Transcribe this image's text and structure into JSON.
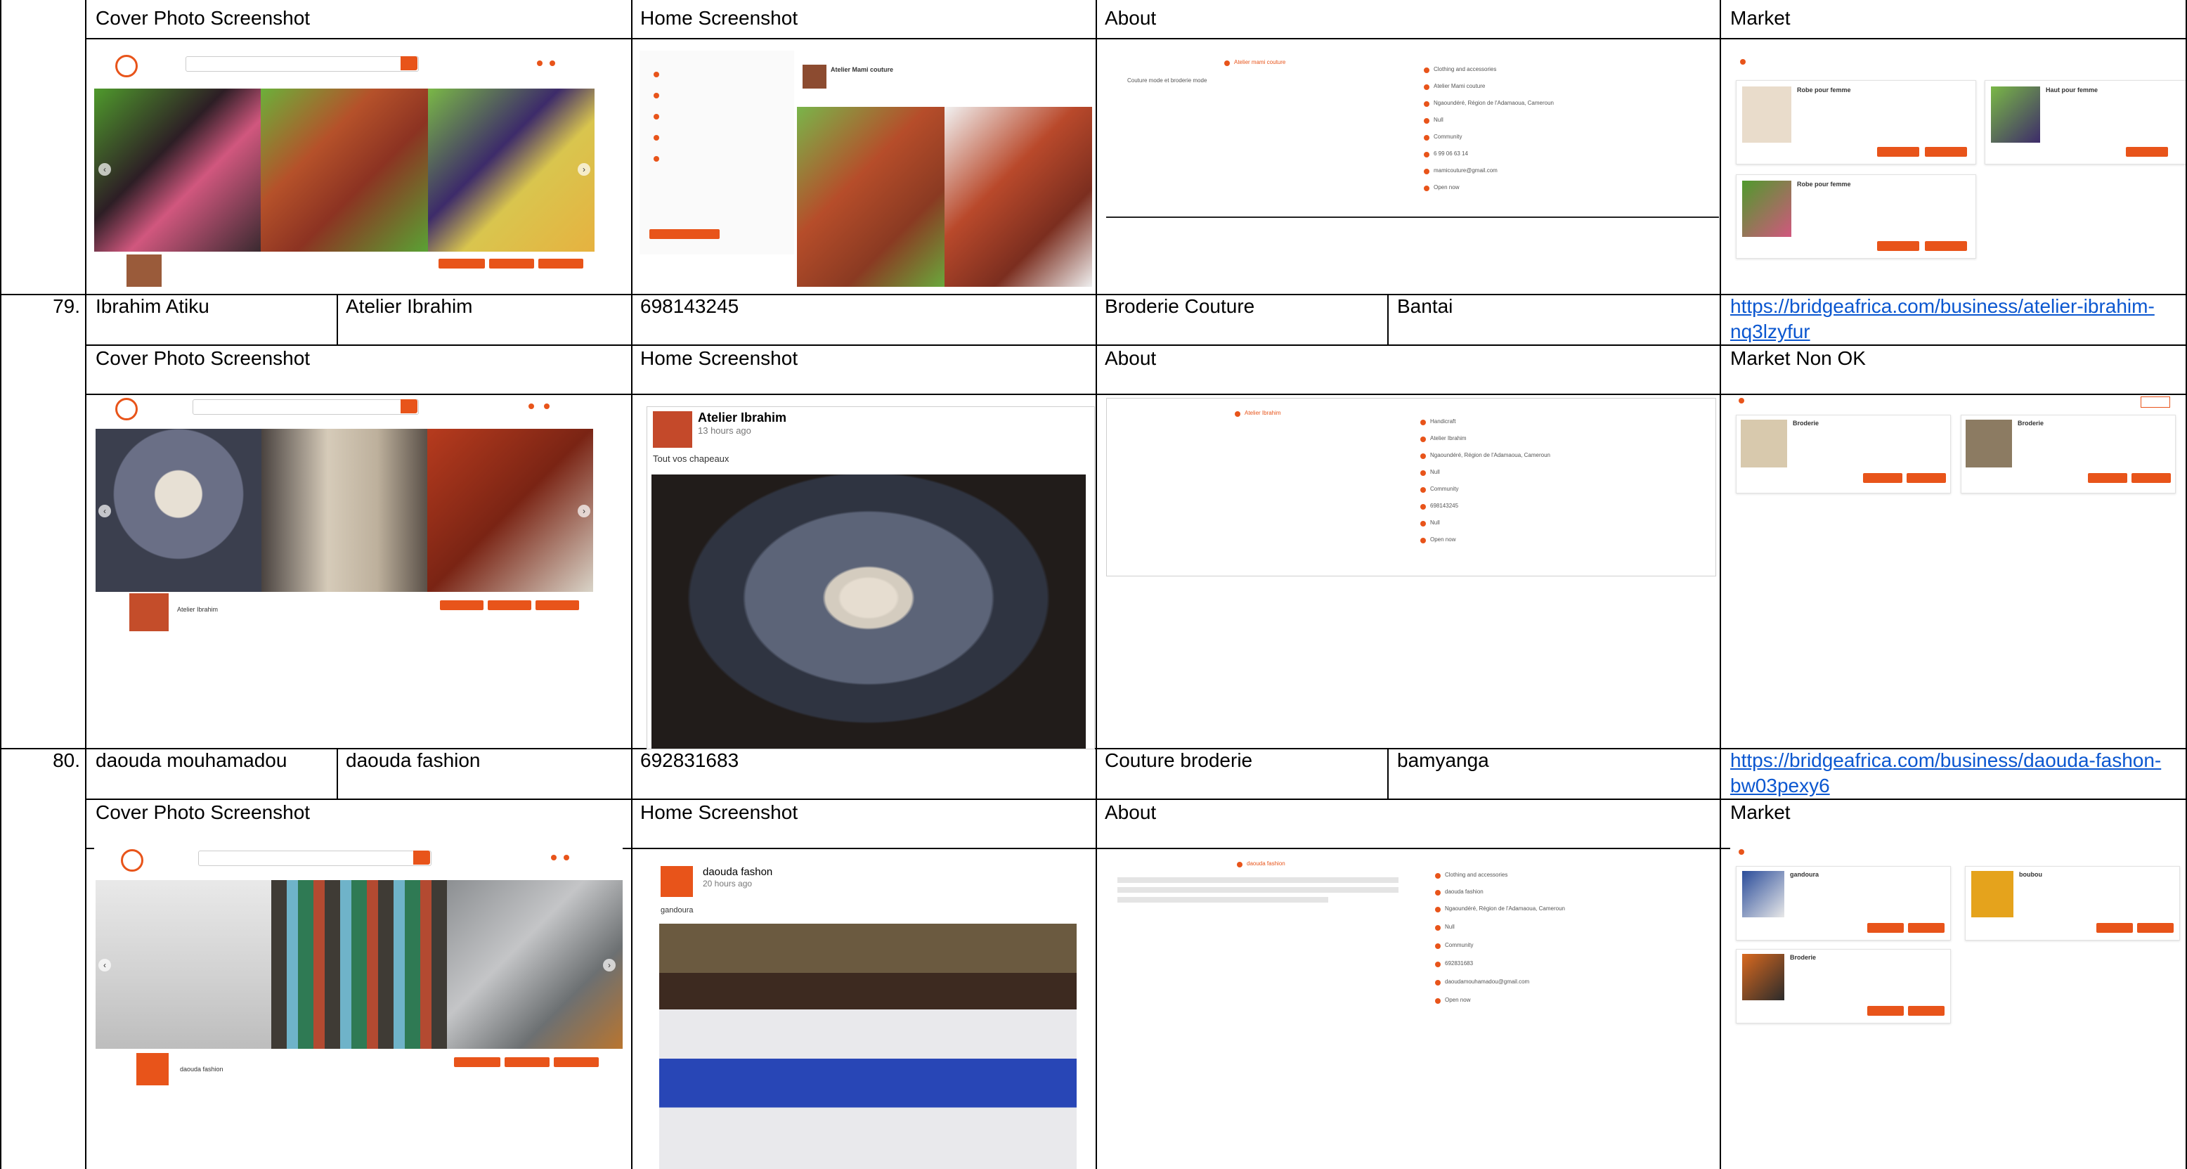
{
  "header_row": {
    "cover": "Cover Photo Screenshot",
    "home": "Home Screenshot",
    "about": "About",
    "market": "Market"
  },
  "records": [
    {
      "number": "79.",
      "owner": "Ibrahim Atiku",
      "business": "Atelier Ibrahim",
      "phone": "698143245",
      "category": "Broderie Couture",
      "location": "Bantai",
      "url": "https://bridgeafrica.com/business/atelier-ibrahim-nq3lzyfur",
      "labels": {
        "cover": "Cover Photo Screenshot",
        "home": "Home Screenshot",
        "about": "About",
        "market": "Market Non OK"
      },
      "home_post": {
        "name": "Atelier Ibrahim",
        "time": "13 hours ago",
        "caption": "Tout vos chapeaux"
      }
    },
    {
      "number": "80.",
      "owner": "daouda mouhamadou",
      "business": "daouda fashion",
      "phone": "692831683",
      "category": "Couture broderie",
      "location": "bamyanga",
      "url": "https://bridgeafrica.com/business/daouda-fashon-bw03pexy6",
      "labels": {
        "cover": "Cover Photo Screenshot",
        "home": "Home Screenshot",
        "about": "About",
        "market": "Market"
      },
      "home_post": {
        "name": "daouda fashon",
        "time": "20 hours ago",
        "caption": "gandoura"
      }
    }
  ],
  "top_shots": {
    "home_profile": "Atelier Mami couture",
    "about_title": "Atelier mami couture",
    "about_desc": "Couture mode et broderie mode",
    "about_items": [
      "Clothing and accessories",
      "Atelier Mami couture",
      "Ngaoundéré, Région de l'Adamaoua, Cameroun",
      "Null",
      "Community",
      "6 99 06 63 14",
      "mamicouture@gmail.com",
      "Open now"
    ],
    "market_items": [
      {
        "title": "Robe pour femme"
      },
      {
        "title": "Haut pour femme"
      },
      {
        "title": "Robe pour femme"
      }
    ]
  },
  "mid_shots": {
    "about_title": "Atelier Ibrahim",
    "about_items": [
      "Handicraft",
      "Atelier Ibrahim",
      "Ngaoundéré, Région de l'Adamaoua, Cameroun",
      "Null",
      "Community",
      "698143245",
      "Null",
      "Open now"
    ],
    "market_items": [
      {
        "title": "Broderie"
      },
      {
        "title": "Broderie"
      }
    ],
    "cover_name": "Atelier Ibrahim"
  },
  "bot_shots": {
    "about_title": "daouda fashion",
    "about_items": [
      "Clothing and accessories",
      "daouda fashion",
      "Ngaoundéré, Région de l'Adamaoua, Cameroun",
      "Null",
      "Community",
      "692831683",
      "daoudamouhamadou@gmail.com",
      "Open now"
    ],
    "market_items": [
      {
        "title": "gandoura"
      },
      {
        "title": "boubou"
      },
      {
        "title": "Broderie"
      }
    ],
    "cover_name": "daouda fashion"
  },
  "colors": {
    "accent": "#e8541a",
    "link": "#0b57d0",
    "rule": "#000000"
  }
}
